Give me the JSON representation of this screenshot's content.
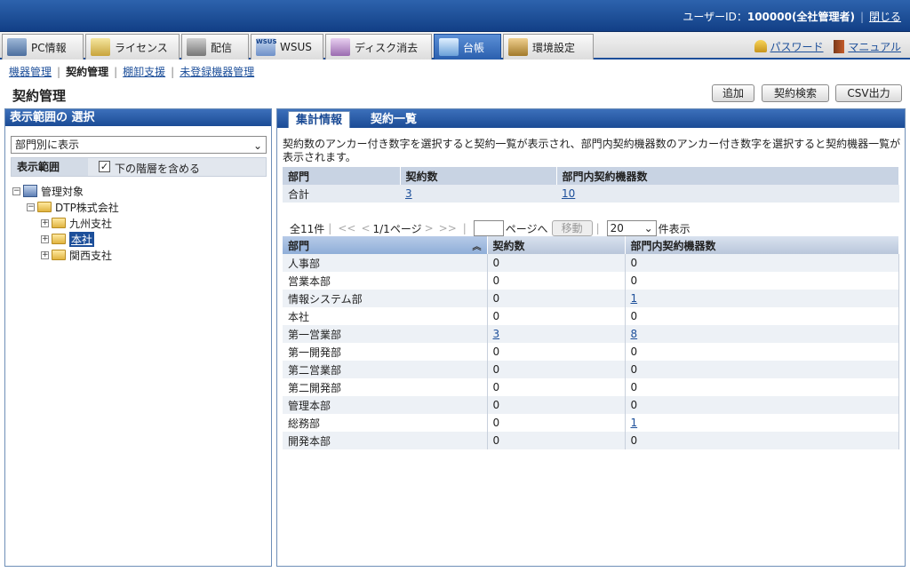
{
  "header": {
    "user_label": "ユーザーID：",
    "user_value": "100000(全社管理者)",
    "close_label": "閉じる"
  },
  "tabs": [
    {
      "label": "PC情報",
      "icon": "pc-icon"
    },
    {
      "label": "ライセンス",
      "icon": "license-icon"
    },
    {
      "label": "配信",
      "icon": "distribution-icon"
    },
    {
      "label": "WSUS",
      "icon": "wsus-icon",
      "icon_text": "WSUS"
    },
    {
      "label": "ディスク消去",
      "icon": "disk-erase-icon"
    },
    {
      "label": "台帳",
      "icon": "ledger-icon",
      "active": true
    },
    {
      "label": "環境設定",
      "icon": "settings-icon"
    }
  ],
  "toplinks": {
    "password": "パスワード",
    "manual": "マニュアル"
  },
  "subnav": {
    "device_mgmt": "機器管理",
    "contract_mgmt": "契約管理",
    "inventory": "棚卸支援",
    "unregistered": "未登録機器管理"
  },
  "page": {
    "title": "契約管理",
    "buttons": {
      "add": "追加",
      "search": "契約検索",
      "csv": "CSV出力"
    }
  },
  "left_panel": {
    "title": "表示範囲の 選択",
    "select_value": "部門別に表示",
    "range_label": "表示範囲",
    "include_lower_label": "下の階層を含める",
    "include_lower_checked": "✓",
    "tree": [
      {
        "label": "管理対象",
        "level": 0,
        "toggle": "⊟",
        "icon": "building"
      },
      {
        "label": "DTP株式会社",
        "level": 1,
        "toggle": "⊟",
        "icon": "folder"
      },
      {
        "label": "九州支社",
        "level": 2,
        "toggle": "⊞",
        "icon": "folder"
      },
      {
        "label": "本社",
        "level": 2,
        "toggle": "⊞",
        "icon": "folder",
        "selected": true
      },
      {
        "label": "関西支社",
        "level": 2,
        "toggle": "⊞",
        "icon": "folder"
      }
    ]
  },
  "right_panel": {
    "tabs": {
      "summary": "集計情報",
      "list": "契約一覧"
    },
    "description": "契約数のアンカー付き数字を選択すると契約一覧が表示され、部門内契約機器数のアンカー付き数字を選択すると契約機器一覧が表示されます。",
    "summary": {
      "headers": [
        "部門",
        "契約数",
        "部門内契約機器数"
      ],
      "row": {
        "dept": "合計",
        "contracts": "3",
        "devices": "10"
      }
    },
    "pager": {
      "total": "全11件",
      "first": "<<",
      "prev": "<",
      "page": "1/1ページ",
      "next": ">",
      "last": ">>",
      "page_to": "ページへ",
      "move": "移動",
      "page_size": "20",
      "per_page": "件表示",
      "chevron": "⌄"
    },
    "list": {
      "headers": [
        "部門",
        "契約数",
        "部門内契約機器数"
      ],
      "sort_icon": "︽",
      "rows": [
        {
          "dept": "人事部",
          "contracts": "0",
          "devices": "0"
        },
        {
          "dept": "営業本部",
          "contracts": "0",
          "devices": "0"
        },
        {
          "dept": "情報システム部",
          "contracts": "0",
          "devices": "1",
          "devices_link": true
        },
        {
          "dept": "本社",
          "contracts": "0",
          "devices": "0"
        },
        {
          "dept": "第一営業部",
          "contracts": "3",
          "devices": "8",
          "contracts_link": true,
          "devices_link": true
        },
        {
          "dept": "第一開発部",
          "contracts": "0",
          "devices": "0"
        },
        {
          "dept": "第二営業部",
          "contracts": "0",
          "devices": "0"
        },
        {
          "dept": "第二開発部",
          "contracts": "0",
          "devices": "0"
        },
        {
          "dept": "管理本部",
          "contracts": "0",
          "devices": "0"
        },
        {
          "dept": "総務部",
          "contracts": "0",
          "devices": "1",
          "devices_link": true
        },
        {
          "dept": "開発本部",
          "contracts": "0",
          "devices": "0"
        }
      ]
    }
  },
  "colors": {
    "header_blue": "#1b4b95",
    "link": "#1d4f9a",
    "row_alt": "#edf1f6"
  }
}
